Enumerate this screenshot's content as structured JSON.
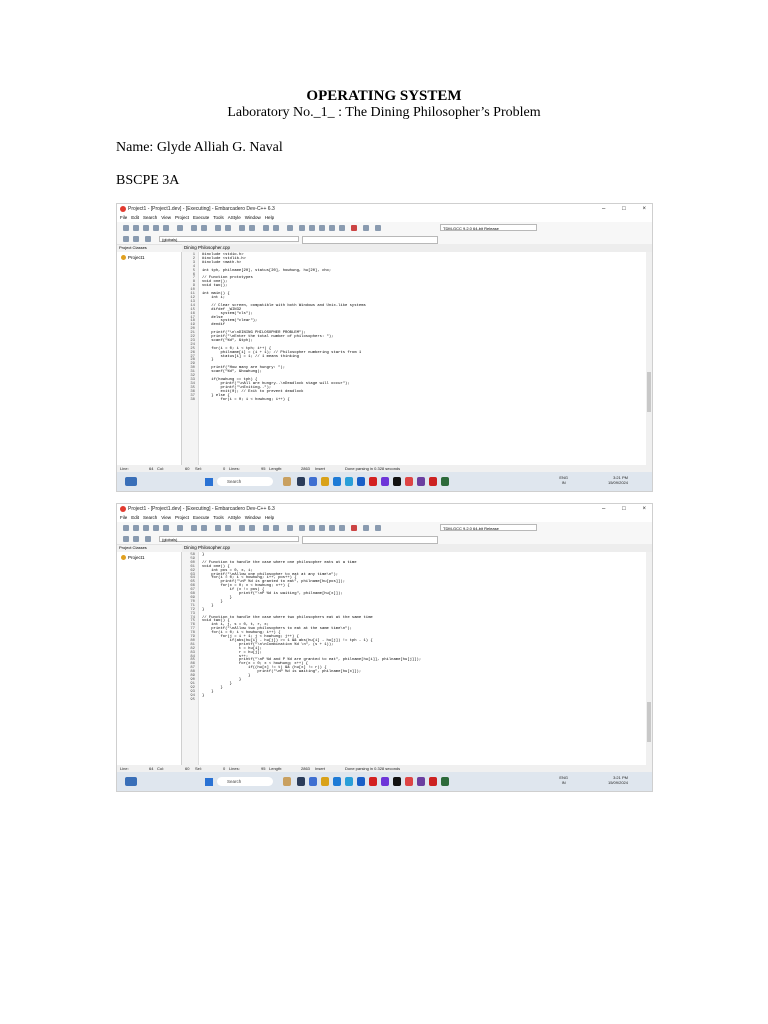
{
  "document": {
    "title": "OPERATING SYSTEM",
    "subtitle": "Laboratory No._1_ : The Dining Philosopher’s Problem",
    "name": "Name: Glyde Alliah G. Naval",
    "section": "BSCPE 3A"
  },
  "ide": {
    "window_title": "Project1 - [Project1.dev] - [Executing] - Embarcadero Dev-C++ 6.3",
    "menu": [
      "File",
      "Edit",
      "Search",
      "View",
      "Project",
      "Execute",
      "Tools",
      "AStyle",
      "Window",
      "Help"
    ],
    "compiler": "TDM-GCC 9.2.0 64-bit Release",
    "scope": "(globals)",
    "panel_tabs": "Project   Classes",
    "project_name": "Project1",
    "file_tab": "Dining Philosopher.cpp",
    "taskbar_search": "Search",
    "lang": "ENG\nIN",
    "clock_time": "3:21 PM",
    "clock_date": "15/09/2024"
  },
  "screenshot1": {
    "line_numbers": "1\n2\n3\n4\n5\n6\n7\n8\n9\n10\n11\n12\n13\n14\n15\n16\n17\n18\n19\n20\n21\n22\n23\n24\n25\n26\n27\n28\n29\n30\n31\n32\n33\n34\n35\n36\n37\n38",
    "code": "#include <stdio.h>\n#include <stdlib.h>\n#include <math.h>\n\nint tph, philname[20], status[20], howhung, hu[20], cho;\n\n// Function prototypes\nvoid one();\nvoid two();\n\nint main() {\n    int i;\n\n    // Clear screen, compatible with both Windows and Unix-like systems\n    #ifdef _WIN32\n        system(\"cls\");\n    #else\n        system(\"clear\");\n    #endif\n\n    printf(\"\\n\\nDINING PHILOSOPHER PROBLEM\");\n    printf(\"\\nEnter the total number of philosophers: \");\n    scanf(\"%d\", &tph);\n\n    for(i = 0; i < tph; i++) {\n        philname[i] = (i + 1); // Philosopher numbering starts from 1\n        status[i] = 1; // 1 means thinking\n    }\n\n    printf(\"How many are hungry: \");\n    scanf(\"%d\", &howhung);\n\n    if(howhung == tph) {\n        printf(\"\\nAll are hungry..\\nDeadlock stage will occur\");\n        printf(\"\\nExiting..\");\n        exit(0); // Exit to prevent deadlock\n    } else {\n        for(i = 0; i < howhung; i++) {",
    "status": {
      "line": "Line:",
      "line_val": "64",
      "col": "Col:",
      "col_val": "60",
      "sel": "Sel:",
      "sel_val": "0",
      "lines": "Lines:",
      "lines_val": "95",
      "length": "Length:",
      "length_val": "2863",
      "mode": "Insert",
      "message": "Done parsing in 0.328 seconds"
    }
  },
  "screenshot2": {
    "line_numbers": "58\n59\n60\n61\n62\n63\n64\n65\n66\n67\n68\n69\n70\n71\n72\n73\n74\n75\n76\n77\n78\n79\n80\n81\n82\n83\n84\n85\n86\n87\n88\n89\n90\n91\n92\n93\n94\n95",
    "code": "}\n\n// Function to handle the case where one philosopher eats at a time\nvoid one() {\n    int pos = 0, x, i;\n    printf(\"\\nAllow one philosopher to eat at any time\\n\");\n    for(i = 0; i < howhung; i++, pos++) {\n        printf(\"\\nP %d is granted to eat\", philname[hu[pos]]);\n        for(x = 0; x < howhung; x++) {\n            if (x != pos) {\n                printf(\"\\nP %d is waiting\", philname[hu[x]]);\n            }\n        }\n    }\n}\n\n// Function to handle the case where two philosophers eat at the same time\nvoid two() {\n    int i, j, s = 0, t, r, x;\n    printf(\"\\nAllow two philosophers to eat at the same time\\n\");\n    for(i = 0; i < howhung; i++) {\n        for(j = i + 1; j < howhung; j++) {\n            if(abs(hu[i] - hu[j]) >= 1 && abs(hu[i] - hu[j]) != tph - 1) {\n                printf(\"\\n\\nCombination %d \\n\", (s + 1));\n                t = hu[i];\n                r = hu[j];\n                s++;\n                printf(\"\\nP %d and P %d are granted to eat\", philname[hu[i]], philname[hu[j]]);\n                for(x = 0; x < howhung; x++) {\n                    if((hu[x] != t) && (hu[x] != r)) {\n                        printf(\"\\nP %d is waiting\", philname[hu[x]]);\n                    }\n                }\n            }\n        }\n    }\n}",
    "status": {
      "line": "Line:",
      "line_val": "64",
      "col": "Col:",
      "col_val": "60",
      "sel": "Sel:",
      "sel_val": "0",
      "lines": "Lines:",
      "lines_val": "95",
      "length": "Length:",
      "length_val": "2863",
      "mode": "Insert",
      "message": "Done parsing in 0.328 seconds"
    }
  },
  "colors": {
    "comment": "#3d7fd6",
    "keyword": "#000000",
    "taskbar": "#dfe6ee"
  }
}
